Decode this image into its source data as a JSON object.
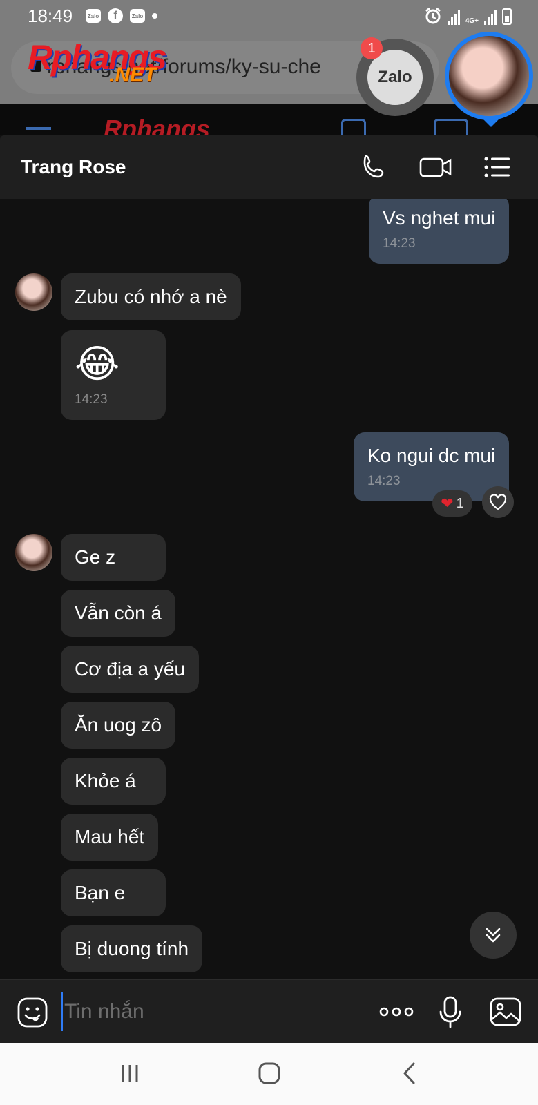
{
  "status_bar": {
    "time": "18:49",
    "left_icons": [
      "zalo-icon",
      "facebook-icon",
      "zalo-icon",
      "dot"
    ],
    "zalo_text": "Zalo",
    "facebook_text": "f",
    "network": "4G+"
  },
  "browser": {
    "url": "rphangs.net/forums/ky-su-che",
    "site_logo_main": "Rphangs",
    "site_logo_suffix": ".NET"
  },
  "zalo_bubble": {
    "label": "Zalo",
    "badge_count": "1"
  },
  "chat": {
    "contact_name": "Trang Rose",
    "messages": [
      {
        "dir": "out",
        "text": "Vs nghet mui",
        "time": "14:23"
      },
      {
        "dir": "in",
        "text": "Zubu có nhớ a nè",
        "time": ""
      },
      {
        "dir": "in",
        "text": "😂",
        "time": "14:23",
        "emoji": true
      },
      {
        "dir": "out",
        "text": "Ko ngui dc mui",
        "time": "14:23"
      },
      {
        "dir": "in",
        "text": "Ge z",
        "time": ""
      },
      {
        "dir": "in",
        "text": "Vẫn còn á",
        "time": ""
      },
      {
        "dir": "in",
        "text": "Cơ địa a yếu",
        "time": ""
      },
      {
        "dir": "in",
        "text": "Ăn uog zô",
        "time": ""
      },
      {
        "dir": "in",
        "text": "Khỏe á",
        "time": ""
      },
      {
        "dir": "in",
        "text": "Mau hết",
        "time": ""
      },
      {
        "dir": "in",
        "text": "Bạn e",
        "time": ""
      },
      {
        "dir": "in",
        "text": "Bị duong tính",
        "time": ""
      }
    ],
    "reaction": {
      "emoji": "❤",
      "count": "1"
    }
  },
  "composer": {
    "placeholder": "Tin nhắn"
  },
  "colors": {
    "accent": "#1e7cf0",
    "incoming_bubble": "#2b2b2b",
    "outgoing_bubble": "#3d4a5c",
    "background": "#111111",
    "badge": "#f04b4b"
  }
}
